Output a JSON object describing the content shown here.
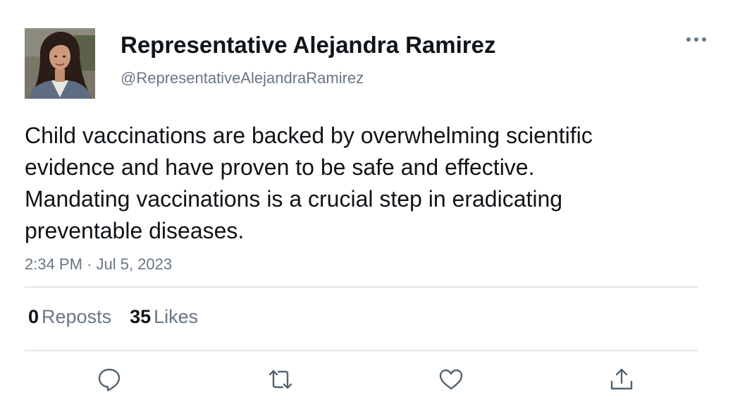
{
  "user": {
    "display_name": "Representative Alejandra Ramirez",
    "handle": "@RepresentativeAlejandraRamirez",
    "avatar_icon": "profile-photo"
  },
  "tweet": {
    "text": "Child vaccinations are backed by overwhelming scientific evidence and have proven to be safe and effective. Mandating vaccinations is a crucial step in eradicating preventable diseases.",
    "timestamp": "2:34 PM · Jul 5, 2023"
  },
  "stats": {
    "reposts_count": "0",
    "reposts_label": "Reposts",
    "likes_count": "35",
    "likes_label": "Likes"
  },
  "actions": {
    "reply_icon": "speech-bubble-icon",
    "repost_icon": "repost-arrows-icon",
    "like_icon": "heart-icon",
    "share_icon": "share-upload-icon",
    "more_icon": "ellipsis-icon"
  },
  "colors": {
    "text": "#0f1419",
    "secondary": "#687684",
    "icon": "#536471",
    "divider": "#e1e5e8"
  }
}
